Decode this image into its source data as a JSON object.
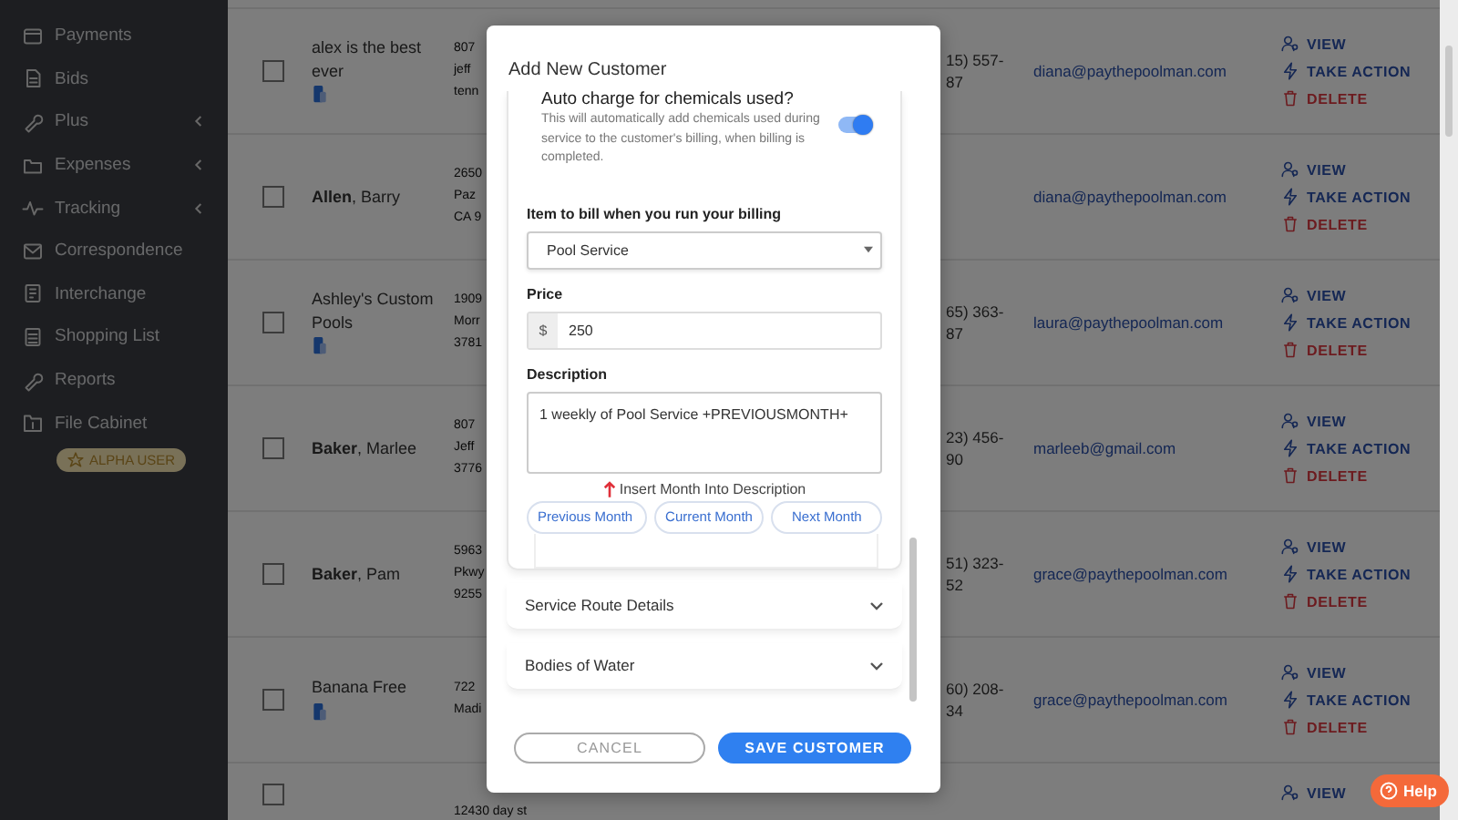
{
  "sidebar": {
    "items": [
      {
        "label": "Payments",
        "has_submenu": false
      },
      {
        "label": "Bids",
        "has_submenu": false
      },
      {
        "label": "Plus",
        "has_submenu": true
      },
      {
        "label": "Expenses",
        "has_submenu": true
      },
      {
        "label": "Tracking",
        "has_submenu": true
      },
      {
        "label": "Correspondence",
        "has_submenu": false
      },
      {
        "label": "Interchange",
        "has_submenu": false
      },
      {
        "label": "Shopping List",
        "has_submenu": false
      },
      {
        "label": "Reports",
        "has_submenu": false
      },
      {
        "label": "File Cabinet",
        "has_submenu": false
      }
    ],
    "badge": "ALPHA USER"
  },
  "table": {
    "rows": [
      {
        "checked": false,
        "name": "alex is the best ever",
        "has_device_icon": true,
        "address": [
          "807",
          "jeff",
          "tenn"
        ],
        "phone": [
          "15) 557-",
          "87"
        ],
        "email": "diana@paythepoolman.com",
        "actions": [
          {
            "kind": "view",
            "label": "VIEW"
          },
          {
            "kind": "take_action",
            "label": "TAKE ACTION"
          },
          {
            "kind": "delete",
            "label": "DELETE"
          }
        ]
      },
      {
        "checked": false,
        "name": "**Allen**, Barry",
        "has_device_icon": false,
        "address": [
          "2650",
          "Paz",
          "CA 9"
        ],
        "phone": [],
        "email": "diana@paythepoolman.com",
        "actions": [
          {
            "kind": "view",
            "label": "VIEW"
          },
          {
            "kind": "take_action",
            "label": "TAKE ACTION"
          },
          {
            "kind": "delete",
            "label": "DELETE"
          }
        ]
      },
      {
        "checked": false,
        "name": "Ashley's Custom Pools",
        "has_device_icon": true,
        "address": [
          "1909",
          "Morr",
          "3781"
        ],
        "phone": [
          "65) 363-",
          "87"
        ],
        "email": "laura@paythepoolman.com",
        "actions": [
          {
            "kind": "view",
            "label": "VIEW"
          },
          {
            "kind": "take_action",
            "label": "TAKE ACTION"
          },
          {
            "kind": "delete",
            "label": "DELETE"
          }
        ]
      },
      {
        "checked": false,
        "name": "**Baker**, Marlee",
        "has_device_icon": false,
        "address": [
          "807",
          "Jeff",
          "3776"
        ],
        "phone": [
          "23) 456-",
          "90"
        ],
        "email": "marleeb@gmail.com",
        "actions": [
          {
            "kind": "view",
            "label": "VIEW"
          },
          {
            "kind": "take_action",
            "label": "TAKE ACTION"
          },
          {
            "kind": "delete",
            "label": "DELETE"
          }
        ]
      },
      {
        "checked": false,
        "name": "**Baker**, Pam",
        "has_device_icon": false,
        "address": [
          "5963",
          "Pkwy",
          "9255"
        ],
        "phone": [
          "51) 323-",
          "52"
        ],
        "email": "grace@paythepoolman.com",
        "actions": [
          {
            "kind": "view",
            "label": "VIEW"
          },
          {
            "kind": "take_action",
            "label": "TAKE ACTION"
          },
          {
            "kind": "delete",
            "label": "DELETE"
          }
        ]
      },
      {
        "checked": false,
        "name": "Banana Free",
        "has_device_icon": true,
        "address": [
          "722",
          "Madi"
        ],
        "phone": [
          "60) 208-",
          "34"
        ],
        "email": "grace@paythepoolman.com",
        "actions": [
          {
            "kind": "view",
            "label": "VIEW"
          },
          {
            "kind": "take_action",
            "label": "TAKE ACTION"
          },
          {
            "kind": "delete",
            "label": "DELETE"
          }
        ]
      },
      {
        "checked": false,
        "name": "",
        "has_device_icon": false,
        "address": [
          "12430 day st"
        ],
        "phone": [],
        "email": "",
        "actions": [
          {
            "kind": "view",
            "label": "VIEW"
          }
        ]
      }
    ]
  },
  "modal": {
    "title": "Add New Customer",
    "auto_charge": {
      "label": "Auto charge for chemicals used?",
      "description": "This will automatically add chemicals used during service to the customer's billing, when billing is completed.",
      "on": true
    },
    "billing_item": {
      "label": "Item to bill when you run your billing",
      "value": "Pool Service"
    },
    "price": {
      "label": "Price",
      "prefix": "$",
      "value": "250"
    },
    "description": {
      "label": "Description",
      "value": "1 weekly of Pool Service +PREVIOUSMONTH+"
    },
    "insert_month": {
      "label": "Insert Month Into Description",
      "buttons": [
        "Previous Month",
        "Current Month",
        "Next Month"
      ]
    },
    "sections": [
      {
        "label": "Service Route Details",
        "expanded": false
      },
      {
        "label": "Bodies of Water",
        "expanded": false
      }
    ],
    "buttons": [
      {
        "kind": "cancel",
        "label": "CANCEL"
      },
      {
        "kind": "primary",
        "label": "SAVE CUSTOMER"
      }
    ]
  },
  "help_button": {
    "label": "Help"
  }
}
